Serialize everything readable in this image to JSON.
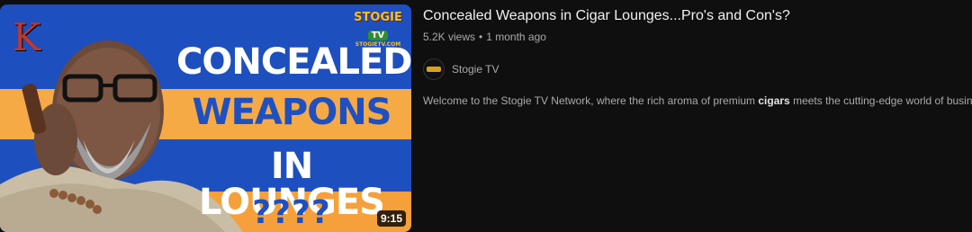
{
  "video": {
    "title": "Concealed Weapons in Cigar Lounges...Pro's and Con's?",
    "views": "5.2K views",
    "age": "1 month ago",
    "duration": "9:15",
    "channel": "Stogie TV",
    "description_before": "Welcome to the Stogie TV Network, where the rich aroma of premium ",
    "description_highlight": "cigars",
    "description_after": " meets the cutting-edge world of business ..."
  },
  "thumbnail": {
    "line1": "CONCEALED",
    "line2": "WEAPONS",
    "line3": "IN LOUNGES",
    "line4": "????",
    "logo_letter": "K",
    "brand_top": "STOGIE",
    "brand_mid": "TV",
    "brand_bottom": "STOGIETV.COM",
    "colors": {
      "blue": "#1d4fbf",
      "orange": "#f5a03a",
      "stripe_blue": "#1e50c2"
    }
  },
  "icons": {
    "channel_avatar": "stogie-tv-avatar-icon"
  }
}
